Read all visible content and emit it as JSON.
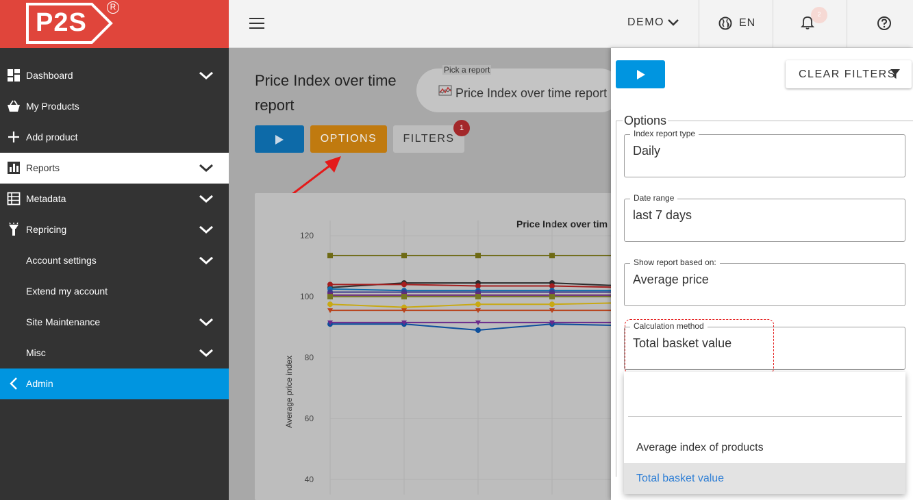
{
  "logo": {
    "text": "P2S",
    "reg": "R"
  },
  "sidebar": {
    "items": [
      {
        "label": "Dashboard",
        "icon": "dashboard-icon",
        "chevron": true
      },
      {
        "label": "My Products",
        "icon": "basket-icon",
        "chevron": false
      },
      {
        "label": "Add product",
        "icon": "plus-icon",
        "chevron": false
      },
      {
        "label": "Reports",
        "icon": "bar-chart-icon",
        "chevron": true,
        "active": true
      },
      {
        "label": "Metadata",
        "icon": "table-icon",
        "chevron": true
      },
      {
        "label": "Repricing",
        "icon": "torch-icon",
        "chevron": true
      },
      {
        "label": "Account settings",
        "icon": "",
        "chevron": true
      },
      {
        "label": "Extend my account",
        "icon": "",
        "chevron": false
      },
      {
        "label": "Site Maintenance",
        "icon": "",
        "chevron": true
      },
      {
        "label": "Misc",
        "icon": "",
        "chevron": true
      },
      {
        "label": "Admin",
        "icon": "chevron-left-icon",
        "chevron": false
      }
    ]
  },
  "topbar": {
    "account": "DEMO",
    "language": "EN",
    "notifications_count": "2"
  },
  "main": {
    "title": "Price Index over time report",
    "pick_report_label": "Pick a report",
    "pick_report_value": "Price Index over time report",
    "options_label": "OPTIONS",
    "filters_label": "FILTERS",
    "filters_badge": "1"
  },
  "panel": {
    "clear_filters_label": "CLEAR FILTERS",
    "options_legend": "Options",
    "fields": [
      {
        "label": "Index report type",
        "value": "Daily"
      },
      {
        "label": "Date range",
        "value": "last 7 days"
      },
      {
        "label": "Show report based on:",
        "value": "Average price"
      },
      {
        "label": "Calculation method",
        "value": "Total basket value"
      }
    ],
    "dropdown_options": [
      "Average index of products",
      "Total basket value"
    ],
    "dropdown_selected": "Total basket value"
  },
  "colors": {
    "brand_red": "#e0453b",
    "admin_blue": "#0095e0",
    "options_orange": "#f09a12",
    "selected_blue": "#2f7fd5"
  },
  "chart_data": {
    "type": "line",
    "title": "Price Index over tim",
    "ylabel": "Average price index",
    "ylim": [
      35,
      125
    ],
    "yticks": [
      40,
      60,
      80,
      100,
      120
    ],
    "x": [
      0,
      1,
      2,
      3,
      4
    ],
    "series": [
      {
        "values": [
          113.5,
          113.5,
          113.5,
          113.5,
          113.5
        ],
        "color": "#6e6a14",
        "marker": "square"
      },
      {
        "values": [
          103,
          104.5,
          104.5,
          104.5,
          103.5
        ],
        "color": "#2b2b2b",
        "marker": "circle"
      },
      {
        "values": [
          104,
          104,
          103.5,
          103.5,
          103
        ],
        "color": "#a51e1e",
        "marker": "circle"
      },
      {
        "values": [
          102.5,
          102,
          102,
          102,
          102
        ],
        "color": "#0d6aa8",
        "marker": "circle"
      },
      {
        "values": [
          101.5,
          101.5,
          101.5,
          101.5,
          101.5
        ],
        "color": "#3b3b8c",
        "marker": "circle"
      },
      {
        "values": [
          100.5,
          100.5,
          100.5,
          100.5,
          100.5
        ],
        "color": "#6a2a7a",
        "marker": "square"
      },
      {
        "values": [
          100,
          100,
          100,
          100,
          100
        ],
        "color": "#777722",
        "marker": "square"
      },
      {
        "values": [
          97.5,
          96.5,
          97.5,
          97.5,
          98
        ],
        "color": "#c8a914",
        "marker": "circle"
      },
      {
        "values": [
          95.5,
          95.5,
          95.5,
          95.5,
          95.5
        ],
        "color": "#b8441e",
        "marker": "triangle"
      },
      {
        "values": [
          91,
          91,
          89,
          91,
          90.5
        ],
        "color": "#0d4f9c",
        "marker": "circle"
      },
      {
        "values": [
          91.5,
          91.5,
          91.5,
          91.5,
          91.5
        ],
        "color": "#6a2a8c",
        "marker": "triangle"
      }
    ]
  }
}
